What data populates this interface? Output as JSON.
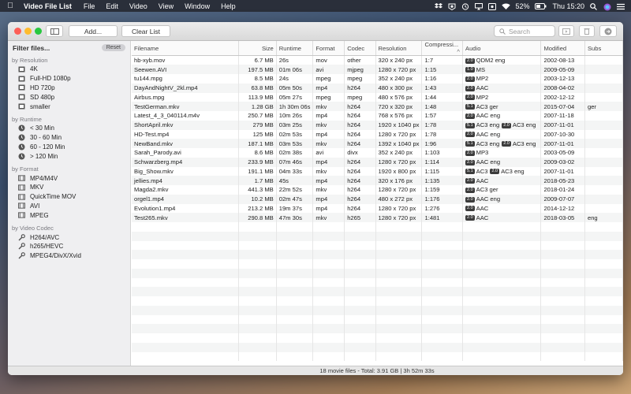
{
  "menubar": {
    "app_name": "Video File List",
    "items": [
      "File",
      "Edit",
      "Video",
      "View",
      "Window",
      "Help"
    ],
    "battery": "52%",
    "clock": "Thu 15:20"
  },
  "toolbar": {
    "add_label": "Add...",
    "clear_label": "Clear List",
    "search_placeholder": "Search"
  },
  "sidebar": {
    "title": "Filter files...",
    "reset_label": "Reset",
    "sections": [
      {
        "title": "by Resolution",
        "items": [
          {
            "label": "4K",
            "icon": "resolution-box-icon"
          },
          {
            "label": "Full-HD 1080p",
            "icon": "resolution-box-icon"
          },
          {
            "label": "HD 720p",
            "icon": "resolution-box-icon"
          },
          {
            "label": "SD 480p",
            "icon": "resolution-box-icon"
          },
          {
            "label": "smaller",
            "icon": "resolution-box-icon"
          }
        ]
      },
      {
        "title": "by Runtime",
        "items": [
          {
            "label": "< 30 Min",
            "icon": "clock-icon"
          },
          {
            "label": "30 - 60 Min",
            "icon": "clock-icon"
          },
          {
            "label": "60 - 120 Min",
            "icon": "clock-icon"
          },
          {
            "label": "> 120 Min",
            "icon": "clock-icon"
          }
        ]
      },
      {
        "title": "by Format",
        "items": [
          {
            "label": "MP4/M4V",
            "icon": "film-icon"
          },
          {
            "label": "MKV",
            "icon": "film-icon"
          },
          {
            "label": "QuickTime MOV",
            "icon": "film-icon"
          },
          {
            "label": "AVI",
            "icon": "film-icon"
          },
          {
            "label": "MPEG",
            "icon": "film-icon"
          }
        ]
      },
      {
        "title": "by Video Codec",
        "items": [
          {
            "label": "H264/AVC",
            "icon": "wrench-icon"
          },
          {
            "label": "h265/HEVC",
            "icon": "wrench-icon"
          },
          {
            "label": "MPEG4/DivX/Xvid",
            "icon": "wrench-icon"
          }
        ]
      }
    ]
  },
  "table": {
    "columns": [
      "Filename",
      "Size",
      "Runtime",
      "Format",
      "Codec",
      "Resolution",
      "Compressi...",
      "Audio",
      "Modified",
      "Subs"
    ],
    "sorted_column": "Compressi...",
    "rows": [
      {
        "filename": "hb-xyb.mov",
        "size": "6.7 MB",
        "runtime": "26s",
        "format": "mov",
        "codec": "other",
        "resolution": "320 x 240 px",
        "compression": "1:7",
        "audio": [
          {
            "badge": "2.0",
            "text": "QDM2 eng"
          }
        ],
        "modified": "2002-08-13",
        "subs": ""
      },
      {
        "filename": "Seewen.AVI",
        "size": "197.5 MB",
        "runtime": "01m 06s",
        "format": "avi",
        "codec": "mjpeg",
        "resolution": "1280 x 720 px",
        "compression": "1:15",
        "audio": [
          {
            "badge": "1.0",
            "text": "MS"
          }
        ],
        "modified": "2009-05-09",
        "subs": ""
      },
      {
        "filename": "tu144.mpg",
        "size": "8.5 MB",
        "runtime": "24s",
        "format": "mpeg",
        "codec": "mpeg",
        "resolution": "352 x 240 px",
        "compression": "1:16",
        "audio": [
          {
            "badge": "2.0",
            "text": "MP2"
          }
        ],
        "modified": "2003-12-13",
        "subs": ""
      },
      {
        "filename": "DayAndNightV_2kl.mp4",
        "size": "63.8 MB",
        "runtime": "05m 50s",
        "format": "mp4",
        "codec": "h264",
        "resolution": "480 x 300 px",
        "compression": "1:43",
        "audio": [
          {
            "badge": "2.0",
            "text": "AAC"
          }
        ],
        "modified": "2008-04-02",
        "subs": ""
      },
      {
        "filename": "Airbus.mpg",
        "size": "113.9 MB",
        "runtime": "05m 27s",
        "format": "mpeg",
        "codec": "mpeg",
        "resolution": "480 x 576 px",
        "compression": "1:44",
        "audio": [
          {
            "badge": "2.0",
            "text": "MP2"
          }
        ],
        "modified": "2002-12-12",
        "subs": ""
      },
      {
        "filename": "TestGerman.mkv",
        "size": "1.28 GB",
        "runtime": "1h 30m 06s",
        "format": "mkv",
        "codec": "h264",
        "resolution": "720 x 320 px",
        "compression": "1:48",
        "audio": [
          {
            "badge": "5.1",
            "text": "AC3 ger"
          }
        ],
        "modified": "2015-07-04",
        "subs": "ger"
      },
      {
        "filename": "Latest_4_3_040114.m4v",
        "size": "250.7 MB",
        "runtime": "10m 26s",
        "format": "mp4",
        "codec": "h264",
        "resolution": "768 x 576 px",
        "compression": "1:57",
        "audio": [
          {
            "badge": "2.0",
            "text": "AAC eng"
          }
        ],
        "modified": "2007-11-18",
        "subs": ""
      },
      {
        "filename": "ShortApril.mkv",
        "size": "279 MB",
        "runtime": "03m 25s",
        "format": "mkv",
        "codec": "h264",
        "resolution": "1920 x 1040 px",
        "compression": "1:78",
        "audio": [
          {
            "badge": "5.1",
            "text": "AC3 eng"
          },
          {
            "badge": "2.0",
            "text": "AC3 eng"
          }
        ],
        "modified": "2007-11-01",
        "subs": ""
      },
      {
        "filename": "HD-Test.mp4",
        "size": "125 MB",
        "runtime": "02m 53s",
        "format": "mp4",
        "codec": "h264",
        "resolution": "1280 x 720 px",
        "compression": "1:78",
        "audio": [
          {
            "badge": "2.0",
            "text": "AAC eng"
          }
        ],
        "modified": "2007-10-30",
        "subs": ""
      },
      {
        "filename": "NewBand.mkv",
        "size": "187.1 MB",
        "runtime": "03m 53s",
        "format": "mkv",
        "codec": "h264",
        "resolution": "1392 x 1040 px",
        "compression": "1:96",
        "audio": [
          {
            "badge": "5.1",
            "text": "AC3 eng"
          },
          {
            "badge": "2.0",
            "text": "AC3 eng"
          }
        ],
        "modified": "2007-11-01",
        "subs": ""
      },
      {
        "filename": "Sarah_Parody.avi",
        "size": "8.6 MB",
        "runtime": "02m 38s",
        "format": "avi",
        "codec": "divx",
        "resolution": "352 x 240 px",
        "compression": "1:103",
        "audio": [
          {
            "badge": "2.0",
            "text": "MP3"
          }
        ],
        "modified": "2003-05-09",
        "subs": ""
      },
      {
        "filename": "Schwarzberg.mp4",
        "size": "233.9 MB",
        "runtime": "07m 46s",
        "format": "mp4",
        "codec": "h264",
        "resolution": "1280 x 720 px",
        "compression": "1:114",
        "audio": [
          {
            "badge": "2.0",
            "text": "AAC eng"
          }
        ],
        "modified": "2009-03-02",
        "subs": ""
      },
      {
        "filename": "Big_Show.mkv",
        "size": "191.1 MB",
        "runtime": "04m 33s",
        "format": "mkv",
        "codec": "h264",
        "resolution": "1920 x 800 px",
        "compression": "1:115",
        "audio": [
          {
            "badge": "5.1",
            "text": "AC3"
          },
          {
            "badge": "2.0",
            "text": "AC3 eng"
          }
        ],
        "modified": "2007-11-01",
        "subs": ""
      },
      {
        "filename": "jellies.mp4",
        "size": "1.7 MB",
        "runtime": "45s",
        "format": "mp4",
        "codec": "h264",
        "resolution": "320 x 176 px",
        "compression": "1:135",
        "audio": [
          {
            "badge": "2.0",
            "text": "AAC"
          }
        ],
        "modified": "2018-05-23",
        "subs": ""
      },
      {
        "filename": "Magda2.mkv",
        "size": "441.3 MB",
        "runtime": "22m 52s",
        "format": "mkv",
        "codec": "h264",
        "resolution": "1280 x 720 px",
        "compression": "1:159",
        "audio": [
          {
            "badge": "2.0",
            "text": "AC3 ger"
          }
        ],
        "modified": "2018-01-24",
        "subs": ""
      },
      {
        "filename": "orgel1.mp4",
        "size": "10.2 MB",
        "runtime": "02m 47s",
        "format": "mp4",
        "codec": "h264",
        "resolution": "480 x 272 px",
        "compression": "1:176",
        "audio": [
          {
            "badge": "2.0",
            "text": "AAC eng"
          }
        ],
        "modified": "2009-07-07",
        "subs": ""
      },
      {
        "filename": "Evolution1.mp4",
        "size": "213.2 MB",
        "runtime": "19m 37s",
        "format": "mp4",
        "codec": "h264",
        "resolution": "1280 x 720 px",
        "compression": "1:276",
        "audio": [
          {
            "badge": "2.0",
            "text": "AAC"
          }
        ],
        "modified": "2014-12-12",
        "subs": ""
      },
      {
        "filename": "Test265.mkv",
        "size": "290.8 MB",
        "runtime": "47m 30s",
        "format": "mkv",
        "codec": "h265",
        "resolution": "1280 x 720 px",
        "compression": "1:481",
        "audio": [
          {
            "badge": "2.0",
            "text": "AAC"
          }
        ],
        "modified": "2018-03-05",
        "subs": "eng"
      }
    ]
  },
  "status": "18 movie files - Total: 3.91 GB | 3h 52m 33s"
}
